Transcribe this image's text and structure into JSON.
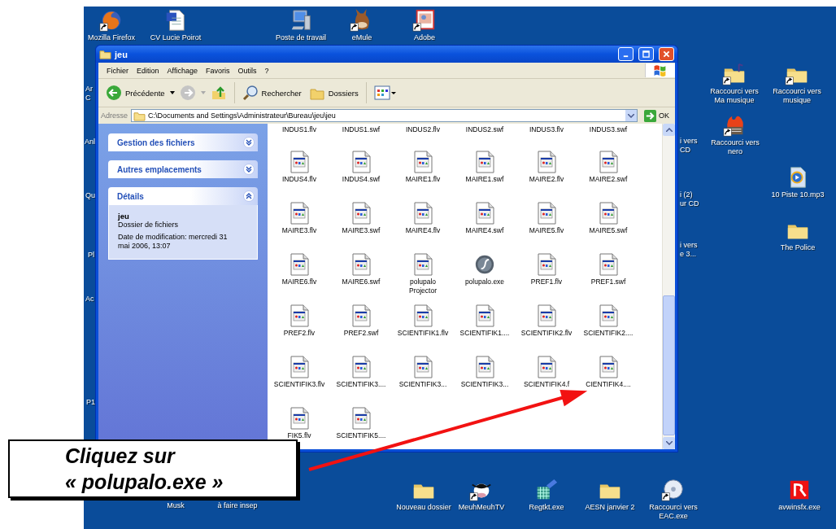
{
  "desktop": {
    "icons": [
      {
        "label": "Mozilla Firefox",
        "kind": "firefox",
        "shortcut": true
      },
      {
        "label": "CV Lucie Poirot",
        "kind": "word",
        "shortcut": false
      },
      {
        "label": "Poste de travail",
        "kind": "computer",
        "shortcut": false
      },
      {
        "label": "eMule",
        "kind": "emule",
        "shortcut": true
      },
      {
        "label": "Adobe",
        "kind": "picture",
        "shortcut": true
      },
      {
        "label": "Raccourci vers\nMa musique",
        "kind": "music-folder",
        "shortcut": true
      },
      {
        "label": "Raccourci vers\nmusique",
        "kind": "folder",
        "shortcut": true
      },
      {
        "label": "Raccourci vers\nnero",
        "kind": "flame",
        "shortcut": true
      },
      {
        "label": "10 Piste 10.mp3",
        "kind": "media",
        "shortcut": false
      },
      {
        "label": "The Police",
        "kind": "folder",
        "shortcut": false
      },
      {
        "label": "Nouveau dossier",
        "kind": "folder",
        "shortcut": false
      },
      {
        "label": "MeuhMeuhTV",
        "kind": "cow",
        "shortcut": true
      },
      {
        "label": "Regtkt.exe",
        "kind": "registry",
        "shortcut": false
      },
      {
        "label": "AESN janvier 2",
        "kind": "folder",
        "shortcut": false
      },
      {
        "label": "Raccourci vers\nEAC.exe",
        "kind": "disc",
        "shortcut": true
      },
      {
        "label": "avwinsfx.exe",
        "kind": "app",
        "shortcut": false
      }
    ],
    "partial_labels": [
      "Ar\nC",
      "Anl",
      "Qu",
      "Pl",
      "Ac",
      "P1",
      "i vers\nCD",
      "i (2)\nur CD",
      "i vers\ne 3...",
      "Musk",
      "à faire insep"
    ]
  },
  "window": {
    "title": "jeu",
    "menu": [
      "Fichier",
      "Edition",
      "Affichage",
      "Favoris",
      "Outils",
      "?"
    ],
    "toolbar": {
      "back": {
        "label": "Précédente"
      },
      "forward": {
        "disabled": true
      },
      "search": {
        "label": "Rechercher"
      },
      "folders": {
        "label": "Dossiers"
      }
    },
    "address": {
      "label": "Adresse",
      "value": "C:\\Documents and Settings\\Administrateur\\Bureau\\jeu\\jeu",
      "go": "OK"
    },
    "task_panels": [
      {
        "title": "Gestion des fichiers",
        "expanded": false
      },
      {
        "title": "Autres emplacements",
        "expanded": false
      },
      {
        "title": "Détails",
        "expanded": true,
        "name": "jeu",
        "type": "Dossier de fichiers",
        "modified": "Date de modification: mercredi 31 mai 2006, 13:07"
      }
    ],
    "files": [
      {
        "name": "INDUS1.flv",
        "kind": "cut"
      },
      {
        "name": "INDUS1.swf",
        "kind": "cut"
      },
      {
        "name": "INDUS2.flv",
        "kind": "cut"
      },
      {
        "name": "INDUS2.swf",
        "kind": "cut"
      },
      {
        "name": "INDUS3.flv",
        "kind": "cut"
      },
      {
        "name": "INDUS3.swf",
        "kind": "cut"
      },
      {
        "name": "INDUS4.flv",
        "kind": "document"
      },
      {
        "name": "INDUS4.swf",
        "kind": "document"
      },
      {
        "name": "MAIRE1.flv",
        "kind": "document"
      },
      {
        "name": "MAIRE1.swf",
        "kind": "document"
      },
      {
        "name": "MAIRE2.flv",
        "kind": "document"
      },
      {
        "name": "MAIRE2.swf",
        "kind": "document"
      },
      {
        "name": "MAIRE3.flv",
        "kind": "document"
      },
      {
        "name": "MAIRE3.swf",
        "kind": "document"
      },
      {
        "name": "MAIRE4.flv",
        "kind": "document"
      },
      {
        "name": "MAIRE4.swf",
        "kind": "document"
      },
      {
        "name": "MAIRE5.flv",
        "kind": "document"
      },
      {
        "name": "MAIRE5.swf",
        "kind": "document"
      },
      {
        "name": "MAIRE6.flv",
        "kind": "document"
      },
      {
        "name": "MAIRE6.swf",
        "kind": "document"
      },
      {
        "name": "polupalo\nProjector",
        "kind": "document"
      },
      {
        "name": "polupalo.exe",
        "kind": "flash"
      },
      {
        "name": "PREF1.flv",
        "kind": "document"
      },
      {
        "name": "PREF1.swf",
        "kind": "document"
      },
      {
        "name": "PREF2.flv",
        "kind": "document"
      },
      {
        "name": "PREF2.swf",
        "kind": "document"
      },
      {
        "name": "SCIENTIFIK1.flv",
        "kind": "document"
      },
      {
        "name": "SCIENTIFIK1....",
        "kind": "document"
      },
      {
        "name": "SCIENTIFIK2.flv",
        "kind": "document"
      },
      {
        "name": "SCIENTIFIK2....",
        "kind": "document"
      },
      {
        "name": "SCIENTIFIK3.flv",
        "kind": "document"
      },
      {
        "name": "SCIENTIFIK3....",
        "kind": "document"
      },
      {
        "name": "SCIENTIFIK3...",
        "kind": "document"
      },
      {
        "name": "SCIENTIFIK3...",
        "kind": "document"
      },
      {
        "name": "SCIENTIFIK4.f",
        "kind": "document"
      },
      {
        "name": "CIENTIFIK4....",
        "kind": "document"
      },
      {
        "name": "FIK5.flv",
        "kind": "document"
      },
      {
        "name": "SCIENTIFIK5....",
        "kind": "document"
      }
    ]
  },
  "callout": {
    "text": "Cliquez sur\n« polupalo.exe »"
  }
}
